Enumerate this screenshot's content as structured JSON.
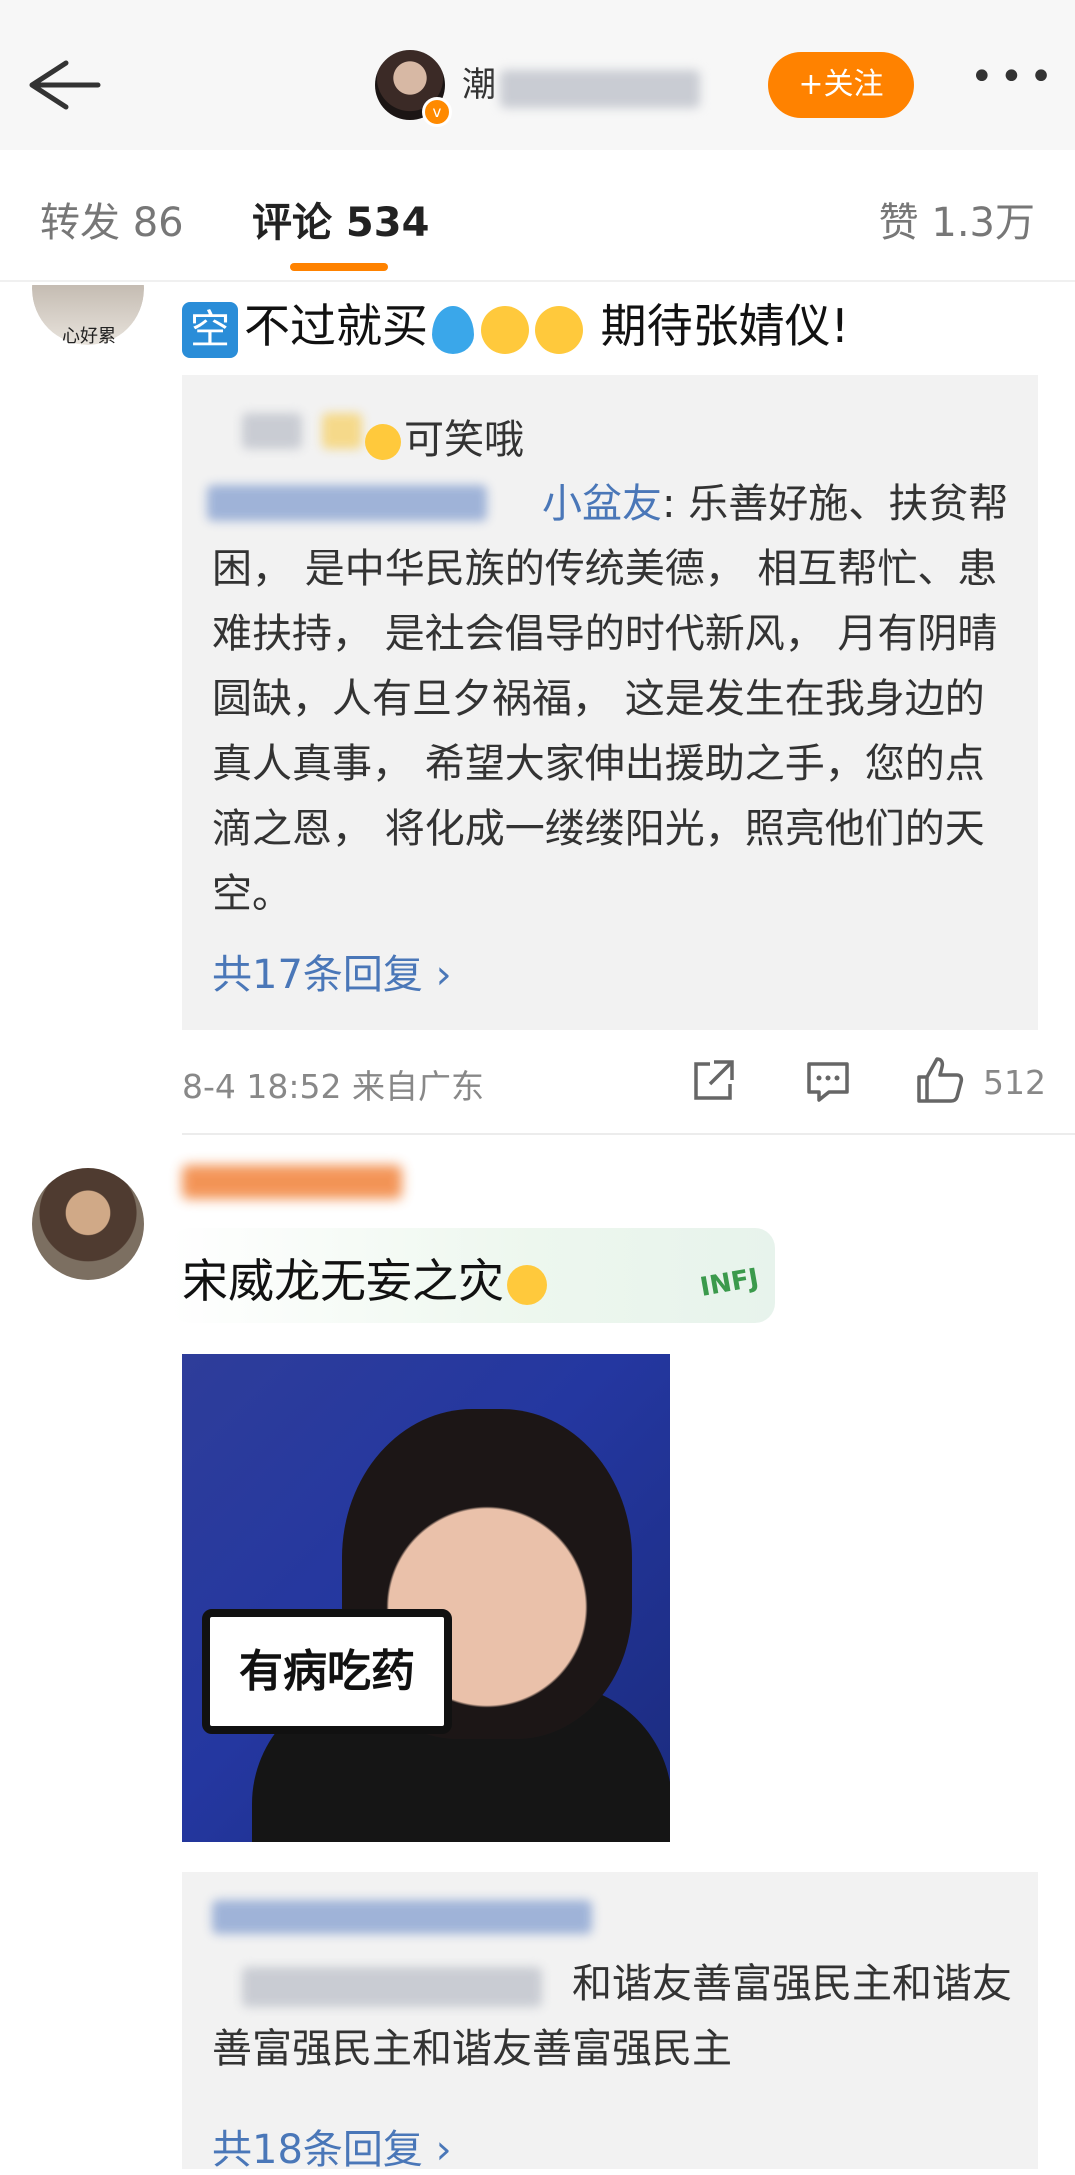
{
  "header": {
    "username_visible": "潮",
    "follow_label": "+关注",
    "more_label": "•••"
  },
  "tabs": {
    "repost": "转发 86",
    "comment": "评论 534",
    "like": "赞 1.3万"
  },
  "comment1": {
    "avatar_caption": "心好累",
    "kong_label": "空",
    "text_a": "不过就买",
    "text_b": " 期待张婧仪!",
    "reply": {
      "user_suffix": "可笑哦",
      "user_link": "小盆友",
      "body": ": 乐善好施、扶贫帮困， 是中华民族的传统美德， 相互帮忙、患难扶持， 是社会倡导的时代新风， 月有阴晴圆缺，人有旦夕祸福， 这是发生在我身边的真人真事， 希望大家伸出援助之手，您的点滴之恩， 将化成一缕缕阳光，照亮他们的天空。",
      "more": "共17条回复 ›"
    },
    "meta": "8-4 18:52  来自广东",
    "like_count": "512"
  },
  "comment2": {
    "text": "宋威龙无妄之灾",
    "badge": "INFJ",
    "image_sign": "有病吃药",
    "reply": {
      "body": "和谐友善富强民主和谐友善富强民主和谐友善富强民主",
      "more": "共18条回复 ›"
    }
  },
  "colors": {
    "accent": "#ff8200",
    "link": "#4a77b8"
  }
}
